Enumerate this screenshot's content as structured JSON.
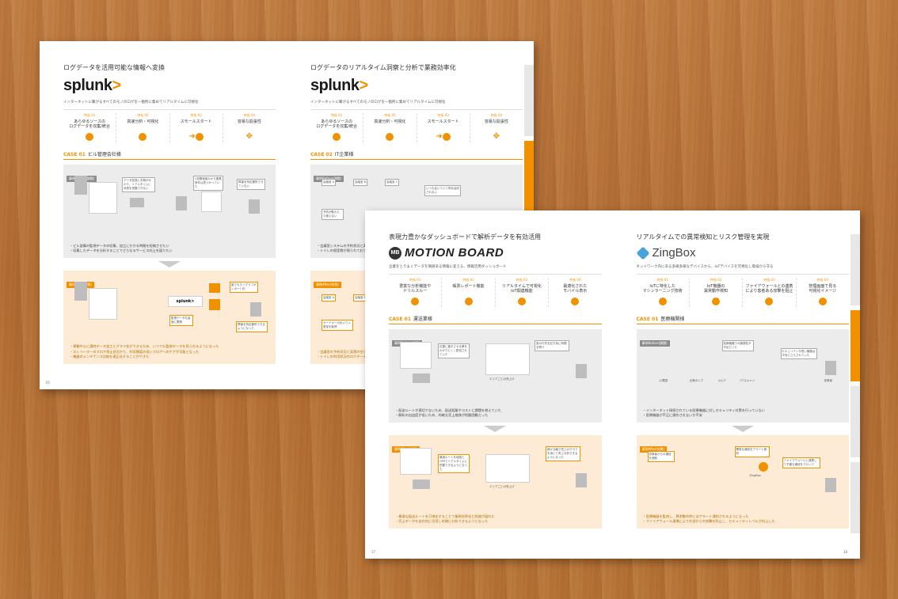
{
  "colors": {
    "accent": "#f29100",
    "wood": "#b97537",
    "zingbox": "#4aa3d8"
  },
  "page_a": {
    "page_number": "65",
    "left": {
      "headline": "ログデータを活用可能な情報へ変換",
      "logo": "splunk",
      "logo_mark": ">",
      "subtitle": "インターネットに繋がるすべてのモノのログを一箇所に集めてリアルタイムに可視化",
      "features": [
        {
          "num": "特長 01",
          "title": "あらゆるソースの\nログデータを収集/統合"
        },
        {
          "num": "特長 02",
          "title": "高速分析・可視化"
        },
        {
          "num": "特長 03",
          "title": "スモールスタート"
        },
        {
          "num": "特長 04",
          "title": "容易な拡張性"
        }
      ],
      "case_label": "CASE 01",
      "case_name": "ビル管理会社様",
      "before_tag": "事例Before(課題)",
      "before_notes": [
        "データ変換に手間がかかり、リアルタイムに状態を把握できない",
        "1週間程度かかり要素条件は見つかっていた",
        "障害を特定箇所できていない"
      ],
      "before_bullets": [
        "・ビル設備の監視データの収集、加工にかかる時間を短縮させたい",
        "・収集したデータを分析することでさらなるサービス向上を図りたい"
      ],
      "after_tag": "事例After(効果)",
      "after_logo": "splunk>",
      "after_notes": [
        "誰でもすぐグラフがレポート化",
        "監視データを高速に蓄積",
        "障害を特定箇所できるようになった"
      ],
      "after_bullets": [
        "・稼働中心に適時データ加工とグラフ化ができるため、いつでも監視データを見られるようになった",
        "・エレベーターのフロア停止状況から、利用頻度の低いフロアへのケアが可能となった",
        "・機器のメンテナンス比較を適正化することができた"
      ]
    },
    "right": {
      "headline": "ログデータのリアルタイム洞察と分析で業務効率化",
      "logo": "splunk",
      "logo_mark": ">",
      "subtitle": "インターネットに繋がるすべてのモノのログを一箇所に集めてリアルタイムに可視化",
      "features": [
        {
          "num": "特長 01",
          "title": "あらゆるソースの\nログデータを収集/統合"
        },
        {
          "num": "特長 02",
          "title": "高速分析・可視化"
        },
        {
          "num": "特長 03",
          "title": "スモールスタート"
        },
        {
          "num": "特長 04",
          "title": "容易な拡張性"
        }
      ],
      "case_label": "CASE 02",
      "case_name": "IT企業様",
      "before_tag": "事例Before(課題)",
      "before_notes": [
        "会議室 A",
        "会議室 B",
        "会議室 C",
        "いつも会いていて有効活用されない",
        "予約が取れたら使えない"
      ],
      "before_bullets": [
        "・会議室システムの予約状況と実際の",
        "・トイレの個室数が限られており待ち"
      ],
      "after_tag": "事例After(効果)",
      "after_notes": [
        "会議室 A",
        "会議室 B",
        "カードキーの出入り入退室を取得"
      ],
      "after_bullets": [
        "・会議室の予約状況と実際の空き状",
        "・トイレの利用状況のログデータを"
      ]
    }
  },
  "page_b": {
    "page_number_left": "37",
    "page_number_right": "38",
    "left": {
      "headline": "表現力豊かなダッシュボードで解析データを有効活用",
      "logo_badge": "MB",
      "logo": "MOTION BOARD",
      "subtitle": "企業をとりまくデータを価値ある情報に変える、情報活用ダッシュボード",
      "features": [
        {
          "num": "特長 01",
          "title": "豊富な分析機能や\nドリルスルー"
        },
        {
          "num": "特長 02",
          "title": "帳票レポート機能"
        },
        {
          "num": "特長 03",
          "title": "リアルタイムで可視化\nIoT関連機能"
        },
        {
          "num": "特長 04",
          "title": "最適化された\nモバイル表示"
        }
      ],
      "case_label": "CASE 01",
      "case_name": "運送業様",
      "before_tag": "事例Before(課題)",
      "before_notes": [
        "位置に集中させる車をわかりにくく配送されていた",
        "各の行先を記す為に時間を問う",
        "エリアごとの売上げ"
      ],
      "before_bullets": [
        "・配送ルートが適切でないため、配送距離やコストに課題を抱えていた",
        "・解析の自由度が低いため、的確な売上推移が把握困難だった"
      ],
      "after_tag": "事例After(効果)",
      "after_notes": [
        "最適ルートを地図とGPSでリアルタイムに把握できるようになった",
        "様々な軸で売上のグラフを用いて売上分析できるようになった",
        "エリアごとの売上げ"
      ],
      "after_bullets": [
        "・最適な配送ルートを可視化することで業務効率化と削減が図れた",
        "・売上データを自在的に活用し的確に分析できるようになった"
      ]
    },
    "right": {
      "headline": "リアルタイムでの異常検知とリスク管理を実現",
      "logo": "ZingBox",
      "subtitle": "ネットワーク内にある多様多様なデバイスから、IoTデバイスを可視化し脅威から守る",
      "features": [
        {
          "num": "特長 01",
          "title": "IoTに特化した\nマシンラーニング技術"
        },
        {
          "num": "特長 02",
          "title": "IoT機器の\n異常動作検知"
        },
        {
          "num": "特長 03",
          "title": "ファイアウォールとの連携\nにより患者ある攻撃を阻止"
        },
        {
          "num": "特長 04",
          "title": "管理画面で見る\n可視化イメージ"
        }
      ],
      "case_label": "CASE 01",
      "case_name": "医療機関様",
      "before_tag": "事例Before(課題)",
      "before_notes": [
        "医療機器での脆弱性が不足だった",
        "セキュリティが低い機器は不安にさらされていた",
        "心電図",
        "点滴ポンプ",
        "カルテ",
        "CTスキャン",
        "攻撃者"
      ],
      "before_bullets": [
        "・インターネット接続されている医療機器に対しセキュリティ対策を行っていない",
        "・医療機器が不正に操作されないか不安"
      ],
      "after_tag": "事例After(効果)",
      "after_notes": [
        "異常な通信をアラート検知",
        "攻撃者からの通信を遮断",
        "ファイアウォールと連携して不審な通信をブロック",
        "ZingBox"
      ],
      "after_bullets": [
        "・医療機器を監視し、異常動作時にはアラート通知されるようになった",
        "・ファイアウォール連携により外部からの攻撃を防止し、セキュリティレベルが向上した"
      ]
    }
  }
}
